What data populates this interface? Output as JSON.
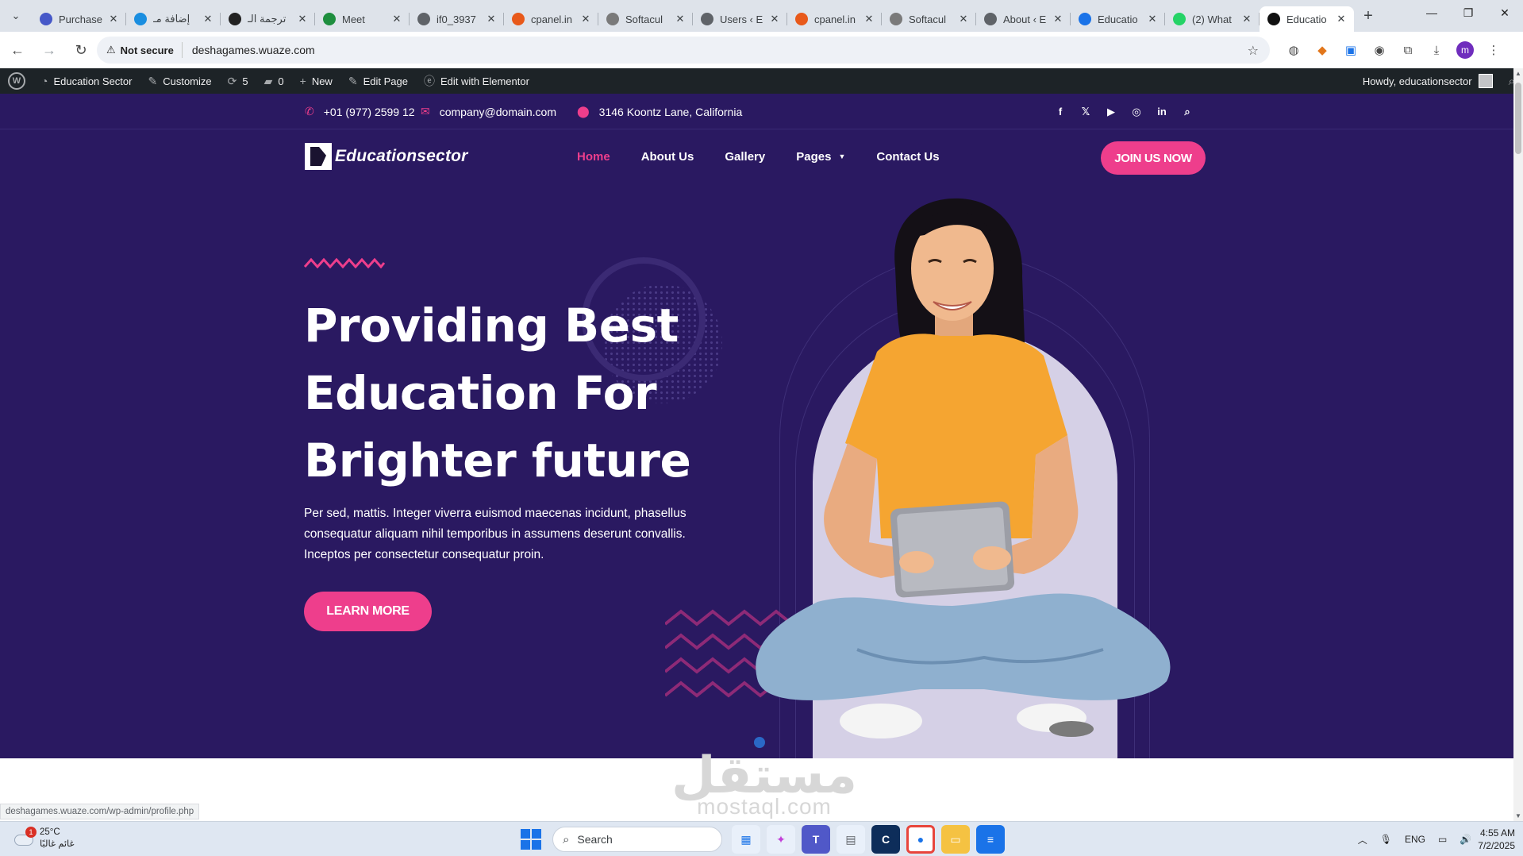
{
  "browser": {
    "tabs": [
      {
        "title": "Purchase",
        "color": "#4658c8"
      },
      {
        "title": "إضافة مـ",
        "color": "#1a8ee0"
      },
      {
        "title": "ترجمة الـ",
        "color": "#222222"
      },
      {
        "title": "Meet",
        "color": "#1e8e3e"
      },
      {
        "title": "if0_3937",
        "color": "#5f6368"
      },
      {
        "title": "cpanel.in",
        "color": "#e8591a"
      },
      {
        "title": "Softacul",
        "color": "#7a7a7a"
      },
      {
        "title": "Users ‹ E",
        "color": "#5f6368"
      },
      {
        "title": "cpanel.in",
        "color": "#e8591a"
      },
      {
        "title": "Softacul",
        "color": "#7a7a7a"
      },
      {
        "title": "About ‹ E",
        "color": "#5f6368"
      },
      {
        "title": "Educatio",
        "color": "#1a73e8"
      },
      {
        "title": "(2) What",
        "color": "#25d366"
      },
      {
        "title": "Educatio",
        "color": "#111111"
      }
    ],
    "security_label": "Not secure",
    "url": "deshagames.wuaze.com",
    "profile_initial": "m",
    "status_url": "deshagames.wuaze.com/wp-admin/profile.php"
  },
  "wp_admin_bar": {
    "site_name": "Education Sector",
    "customize": "Customize",
    "updates_count": "5",
    "comments_count": "0",
    "new": "New",
    "edit_page": "Edit Page",
    "edit_elementor": "Edit with Elementor",
    "howdy": "Howdy, educationsector"
  },
  "site": {
    "phone": "+01 (977) 2599 12",
    "email": "company@domain.com",
    "address": "3146 Koontz Lane, California",
    "logo_text": "Educationsector",
    "nav": {
      "home": "Home",
      "about": "About Us",
      "gallery": "Gallery",
      "pages": "Pages",
      "contact": "Contact Us"
    },
    "join_button": "JOIN US NOW",
    "hero": {
      "line1": "Providing Best",
      "line2": "Education For",
      "line3": "Brighter future",
      "text": "Per sed, mattis. Integer viverra euismod maecenas incidunt, phasellus consequatur aliquam nihil temporibus in assumens deserunt convallis. Inceptos per consectetur consequatur proin.",
      "button": "LEARN MORE"
    },
    "accent_color": "#ee3e8c",
    "background_color": "#2a1961"
  },
  "watermark": {
    "arabic": "مستقل",
    "latin": "mostaql.com"
  },
  "taskbar": {
    "temperature": "25°C",
    "weather_text": "غائم غالبًا",
    "notification_count": "1",
    "search_placeholder": "Search",
    "language": "ENG",
    "time": "4:55 AM",
    "date": "7/2/2025"
  }
}
